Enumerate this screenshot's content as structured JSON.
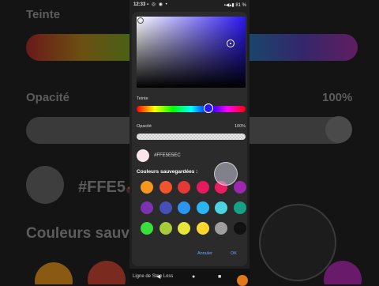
{
  "background": {
    "label_hue": "Teinte",
    "label_opacity": "Opacité",
    "opacity_value": "100%",
    "hex_value": "#FFE5",
    "saved_title": "Couleurs sauv"
  },
  "status_bar": {
    "time": "12:33",
    "battery": "81 %"
  },
  "picker": {
    "selected_color": "#FEE5EC",
    "hue_label": "Teinte",
    "opacity_label": "Opacité",
    "opacity_value": "100%",
    "opacity_level": 1.0,
    "hex_value": "#FFE5E5EC",
    "saved_colors_title": "Couleurs sauvegardées :",
    "saved_colors": [
      "#f5961e",
      "#f0542c",
      "#e53935",
      "#e5195f",
      "#e91e63",
      "#9c27b0",
      "#7b32b0",
      "#4450b5",
      "#2996f2",
      "#29b6f6",
      "#4dd4e0",
      "#16a085",
      "#3ae03a",
      "#a6cc3a",
      "#e6e63a",
      "#ffd52e",
      "#9e9e9e",
      "#111111"
    ],
    "cancel_label": "Annuler",
    "ok_label": "OK"
  },
  "bottom_text": "Ligne de Stop Loss",
  "icons": {
    "pencil": "pencil-icon",
    "back": "nav-back-icon",
    "home": "nav-home-icon",
    "recents": "nav-recents-icon"
  }
}
